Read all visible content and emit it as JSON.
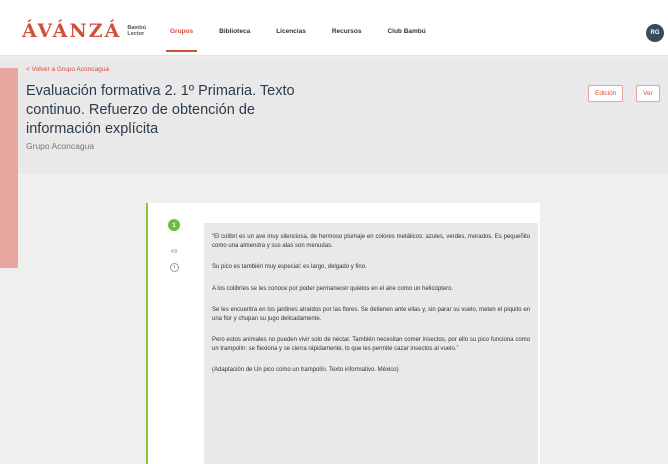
{
  "topbar": {
    "logo_main": "ÁVÁNZÁ",
    "logo_sub_1": "Bambú",
    "logo_sub_2": "Lector",
    "nav": [
      {
        "label": "Grupos",
        "active": true
      },
      {
        "label": "Biblioteca",
        "active": false
      },
      {
        "label": "Licencias",
        "active": false
      },
      {
        "label": "Recursos",
        "active": false
      },
      {
        "label": "Club Bambú",
        "active": false
      }
    ],
    "avatar_initials": "RG"
  },
  "header": {
    "back_link": "< Volver a Grupo Aconcagua",
    "title": "Evaluación formativa 2. 1º Primaria. Texto continuo. Refuerzo de obtención de información explícita",
    "subtitle": "Grupo Aconcagua",
    "edit_button": "Edición",
    "view_button": "Ver"
  },
  "card": {
    "step_number": "1",
    "step_label": "4/8",
    "paragraphs": [
      "“El colibrí es un ave muy silenciosa, de hermoso plumaje en colores metálicos: azules, verdes, morados. Es pequeñito como una almendra y sus alas son menudas.",
      "Su pico es también muy especial: es largo, delgado y fino.",
      "A los colibríes se les conoce por poder permanecer quietos en el aire como un helicóptero.",
      "Se les encuentra en los jardines atraídos por las flores. Se detienen ante ellas y, sin parar su vuelo, meten el piquito en una flor y chupan su jugo delicadamente.",
      "Pero estos animales no pueden vivir solo de néctar. También necesitan comer insectos, por ello su pico funciona como un trampolín: se flexiona y se cierra rápidamente, lo que les permite cazar insectos al vuelo.”",
      "(Adaptación de Un pico como un trampolín. Texto informativo. México)"
    ]
  },
  "colors": {
    "brand": "#d0503c",
    "accent_green": "#6abf3a",
    "side_accent": "#e8a6a0"
  }
}
